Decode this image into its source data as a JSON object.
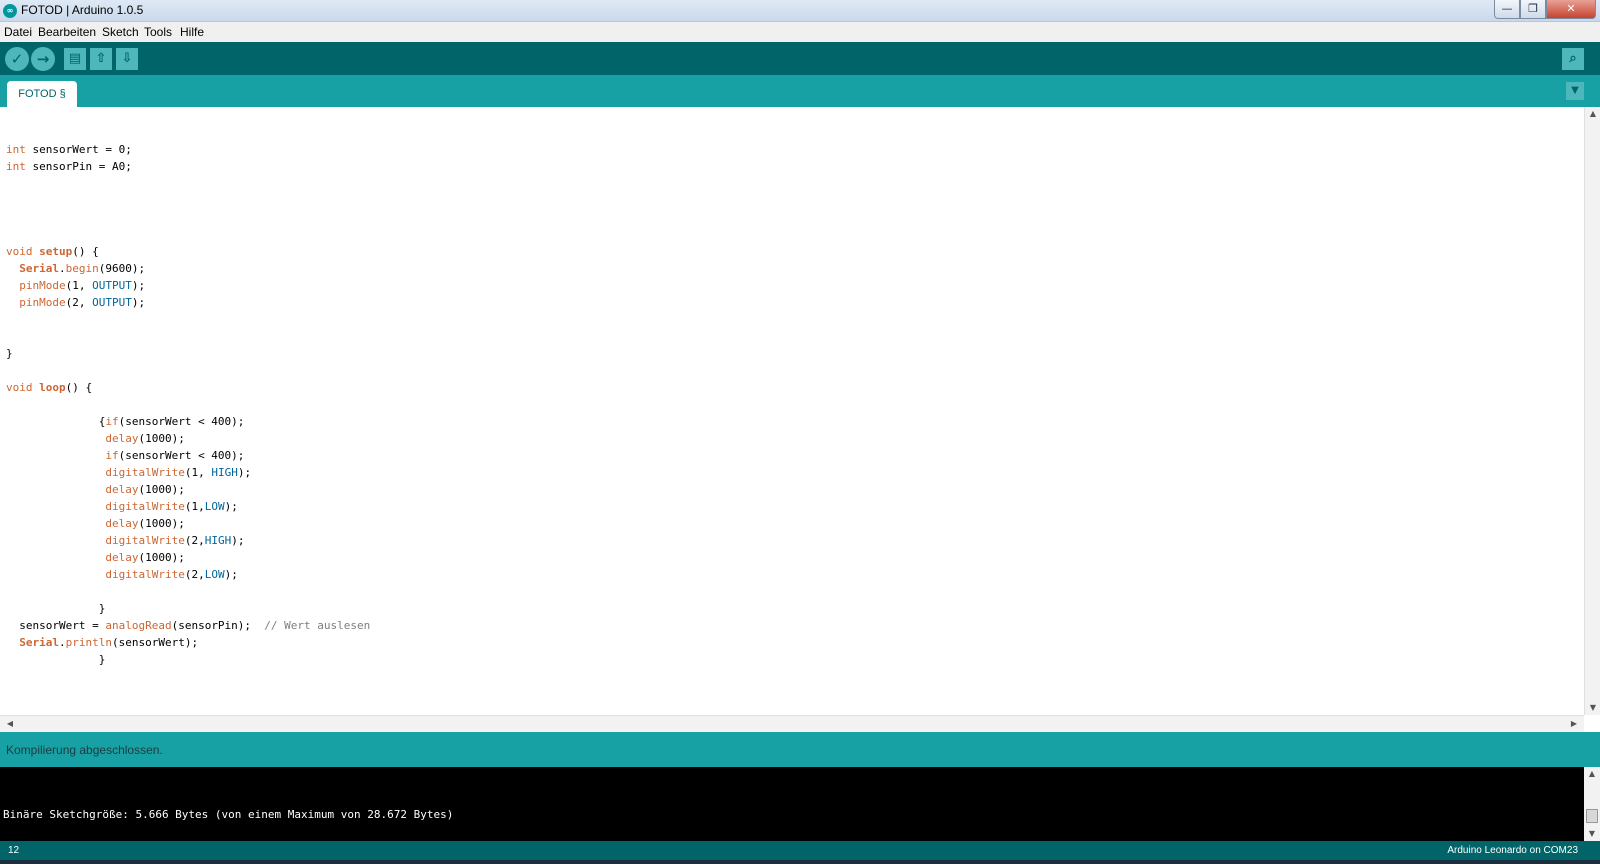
{
  "window": {
    "title": "FOTOD | Arduino 1.0.5",
    "logo_text": "∞",
    "minimize_icon": "—",
    "maximize_icon": "❐",
    "close_icon": "✕"
  },
  "menu": [
    "Datei",
    "Bearbeiten",
    "Sketch",
    "Tools",
    "Hilfe"
  ],
  "toolbar": {
    "verify_icon": "✓",
    "upload_icon": "→",
    "new_icon": "▤",
    "open_icon": "⇧",
    "save_icon": "⇩",
    "serial_monitor_icon": "⌕"
  },
  "tabs": [
    {
      "label": "FOTOD §",
      "active": true
    }
  ],
  "tab_menu_icon": "▼",
  "editor": {
    "code_lines": [
      [],
      [
        [
          "t",
          "int"
        ],
        [
          "n",
          " sensorWert = 0;"
        ]
      ],
      [
        [
          "t",
          "int"
        ],
        [
          "n",
          " sensorPin = A0;"
        ]
      ],
      [],
      [],
      [],
      [],
      [
        [
          "t",
          "void"
        ],
        [
          "n",
          " "
        ],
        [
          "s",
          "setup"
        ],
        [
          "n",
          "() {"
        ]
      ],
      [
        [
          "n",
          "  "
        ],
        [
          "s",
          "Serial"
        ],
        [
          "n",
          "."
        ],
        [
          "f",
          "begin"
        ],
        [
          "n",
          "(9600);"
        ]
      ],
      [
        [
          "n",
          "  "
        ],
        [
          "f",
          "pinMode"
        ],
        [
          "n",
          "(1, "
        ],
        [
          "c",
          "OUTPUT"
        ],
        [
          "n",
          ");"
        ]
      ],
      [
        [
          "n",
          "  "
        ],
        [
          "f",
          "pinMode"
        ],
        [
          "n",
          "(2, "
        ],
        [
          "c",
          "OUTPUT"
        ],
        [
          "n",
          ");"
        ]
      ],
      [],
      [],
      [
        [
          "n",
          "}"
        ]
      ],
      [],
      [
        [
          "t",
          "void"
        ],
        [
          "n",
          " "
        ],
        [
          "s",
          "loop"
        ],
        [
          "n",
          "() {"
        ]
      ],
      [],
      [
        [
          "n",
          "              {"
        ],
        [
          "k",
          "if"
        ],
        [
          "n",
          "(sensorWert < 400);"
        ]
      ],
      [
        [
          "n",
          "               "
        ],
        [
          "f",
          "delay"
        ],
        [
          "n",
          "(1000);"
        ]
      ],
      [
        [
          "n",
          "               "
        ],
        [
          "k",
          "if"
        ],
        [
          "n",
          "(sensorWert < 400);"
        ]
      ],
      [
        [
          "n",
          "               "
        ],
        [
          "f",
          "digitalWrite"
        ],
        [
          "n",
          "(1, "
        ],
        [
          "c",
          "HIGH"
        ],
        [
          "n",
          ");"
        ]
      ],
      [
        [
          "n",
          "               "
        ],
        [
          "f",
          "delay"
        ],
        [
          "n",
          "(1000);"
        ]
      ],
      [
        [
          "n",
          "               "
        ],
        [
          "f",
          "digitalWrite"
        ],
        [
          "n",
          "(1,"
        ],
        [
          "c",
          "LOW"
        ],
        [
          "n",
          ");"
        ]
      ],
      [
        [
          "n",
          "               "
        ],
        [
          "f",
          "delay"
        ],
        [
          "n",
          "(1000);"
        ]
      ],
      [
        [
          "n",
          "               "
        ],
        [
          "f",
          "digitalWrite"
        ],
        [
          "n",
          "(2,"
        ],
        [
          "c",
          "HIGH"
        ],
        [
          "n",
          ");"
        ]
      ],
      [
        [
          "n",
          "               "
        ],
        [
          "f",
          "delay"
        ],
        [
          "n",
          "(1000);"
        ]
      ],
      [
        [
          "n",
          "               "
        ],
        [
          "f",
          "digitalWrite"
        ],
        [
          "n",
          "(2,"
        ],
        [
          "c",
          "LOW"
        ],
        [
          "n",
          ");"
        ]
      ],
      [],
      [
        [
          "n",
          "              }"
        ]
      ],
      [
        [
          "n",
          "  sensorWert = "
        ],
        [
          "f",
          "analogRead"
        ],
        [
          "n",
          "(sensorPin);  "
        ],
        [
          "m",
          "// Wert auslesen"
        ]
      ],
      [
        [
          "n",
          "  "
        ],
        [
          "s",
          "Serial"
        ],
        [
          "n",
          "."
        ],
        [
          "f",
          "println"
        ],
        [
          "n",
          "(sensorWert);"
        ]
      ],
      [
        [
          "n",
          "              }"
        ]
      ]
    ],
    "scroll_up_icon": "▲",
    "scroll_down_icon": "▼",
    "scroll_left_icon": "◀",
    "scroll_right_icon": "▶"
  },
  "status": {
    "message": "Kompilierung abgeschlossen."
  },
  "console": {
    "output": "Binäre Sketchgröße: 5.666 Bytes (von einem Maximum von 28.672 Bytes)"
  },
  "footer": {
    "line_number": "12",
    "board": "Arduino Leonardo on COM23"
  },
  "colors": {
    "toolbar": "#006468",
    "tabstrip": "#17a1a5",
    "keyword": "#cc6633",
    "constant": "#006699",
    "comment": "#7e7e7e"
  }
}
